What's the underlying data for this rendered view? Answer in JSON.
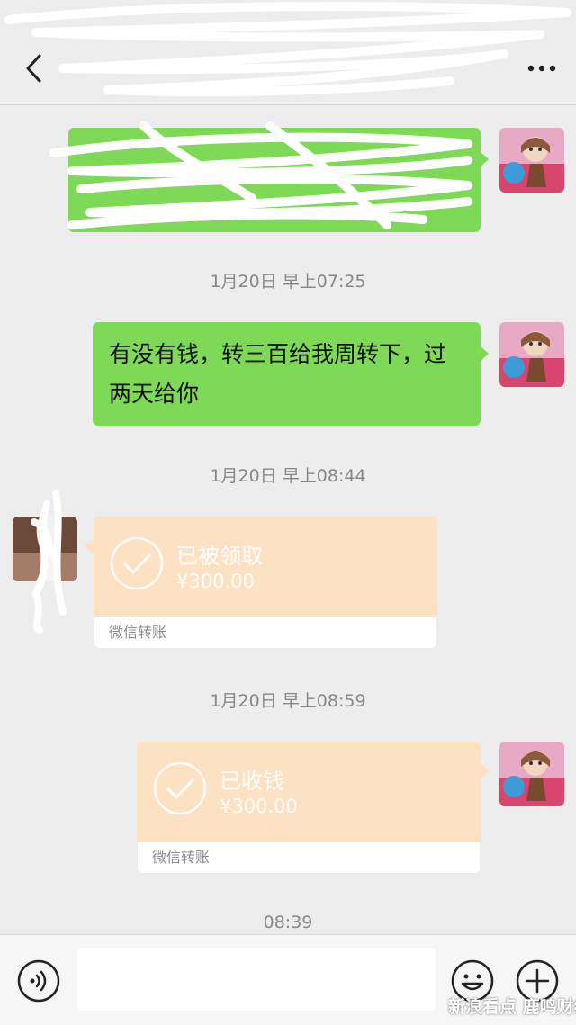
{
  "header": {
    "title": "",
    "back_icon": "chevron-left-icon",
    "more_icon": "more-dots-icon"
  },
  "messages": {
    "ts1": "1月20日 早上07:25",
    "text1": "有没有钱，转三百给我周转下，过两天给你",
    "ts2": "1月20日 早上08:44",
    "transfer1": {
      "status": "已被领取",
      "amount": "¥300.00",
      "footer": "微信转账"
    },
    "ts3": "1月20日 早上08:59",
    "transfer2": {
      "status": "已收钱",
      "amount": "¥300.00",
      "footer": "微信转账"
    },
    "ts4": "08:39"
  },
  "input_bar": {
    "placeholder": "",
    "voice_icon": "voice-icon",
    "emoji_icon": "emoji-icon",
    "plus_icon": "plus-icon"
  },
  "watermark": "新浪看点 鹿鸣财经",
  "colors": {
    "green_bubble": "#7ed957",
    "transfer_bg": "#fde1c3",
    "background": "#ededed"
  }
}
